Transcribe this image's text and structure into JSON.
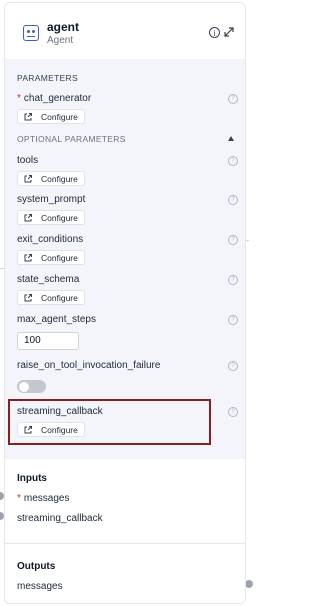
{
  "node": {
    "title": "agent",
    "subtitle": "Agent",
    "icon": "agent-robot-icon",
    "accent": "#3b5bdb"
  },
  "parameters": {
    "section_label": "PARAMETERS",
    "required": [
      {
        "name": "chat_generator",
        "required_mark": "*",
        "button_label": "Configure"
      }
    ],
    "optional_label": "OPTIONAL PARAMETERS",
    "optional": [
      {
        "name": "tools",
        "button_label": "Configure"
      },
      {
        "name": "system_prompt",
        "button_label": "Configure"
      },
      {
        "name": "exit_conditions",
        "button_label": "Configure"
      },
      {
        "name": "state_schema",
        "button_label": "Configure"
      },
      {
        "name": "max_agent_steps",
        "value": "100"
      },
      {
        "name": "raise_on_tool_invocation_failure",
        "toggle": false
      },
      {
        "name": "streaming_callback",
        "button_label": "Configure"
      }
    ],
    "highlight_color": "#8b1e1e"
  },
  "inputs": {
    "title": "Inputs",
    "items": [
      {
        "name": "messages",
        "required_mark": "*"
      },
      {
        "name": "streaming_callback"
      }
    ]
  },
  "outputs": {
    "title": "Outputs",
    "items": [
      {
        "name": "messages"
      }
    ]
  }
}
